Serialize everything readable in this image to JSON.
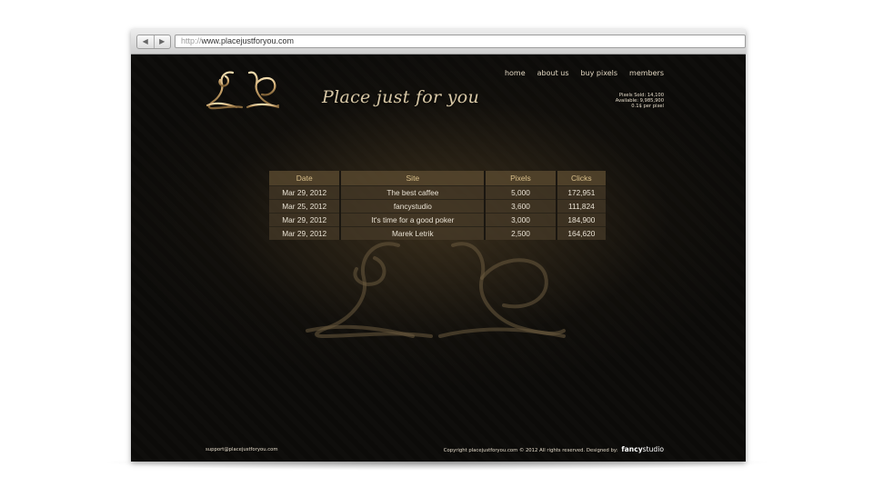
{
  "browser": {
    "url_protocol": "http://",
    "url_host": "www.placejustforyou.com",
    "back_glyph": "◀",
    "forward_glyph": "▶"
  },
  "site": {
    "tagline": "Place just for you",
    "nav": [
      "home",
      "about us",
      "buy pixels",
      "members"
    ],
    "stats": {
      "pixels_sold": "Pixels Sold: 14,100",
      "available": "Available: 9,985,900",
      "price": "0.1$ per pixel"
    }
  },
  "table": {
    "headers": [
      "Date",
      "Site",
      "Pixels",
      "Clicks"
    ],
    "rows": [
      [
        "Mar 29, 2012",
        "The best caffee",
        "5,000",
        "172,951"
      ],
      [
        "Mar 25, 2012",
        "fancystudio",
        "3,600",
        "111,824"
      ],
      [
        "Mar 29, 2012",
        "It's time for a good poker",
        "3,000",
        "184,900"
      ],
      [
        "Mar 29, 2012",
        "Marek Letrik",
        "2,500",
        "164,620"
      ]
    ]
  },
  "footer": {
    "email": "support@placejustforyou.com",
    "copyright": "Copyright placejustforyou.com © 2012 All rights reserved. Designed by:",
    "designer_bold": "fancy",
    "designer_rest": "studio"
  },
  "colors": {
    "page_background": "#0c0b09",
    "gold": "#c9a36a",
    "header_cell": "#58482e",
    "text_light": "#e9e2d4"
  },
  "icons": {
    "back": "back-arrow-icon",
    "forward": "forward-arrow-icon",
    "logo": "ld-monogram-logo",
    "watermark": "ld-monogram-watermark"
  }
}
